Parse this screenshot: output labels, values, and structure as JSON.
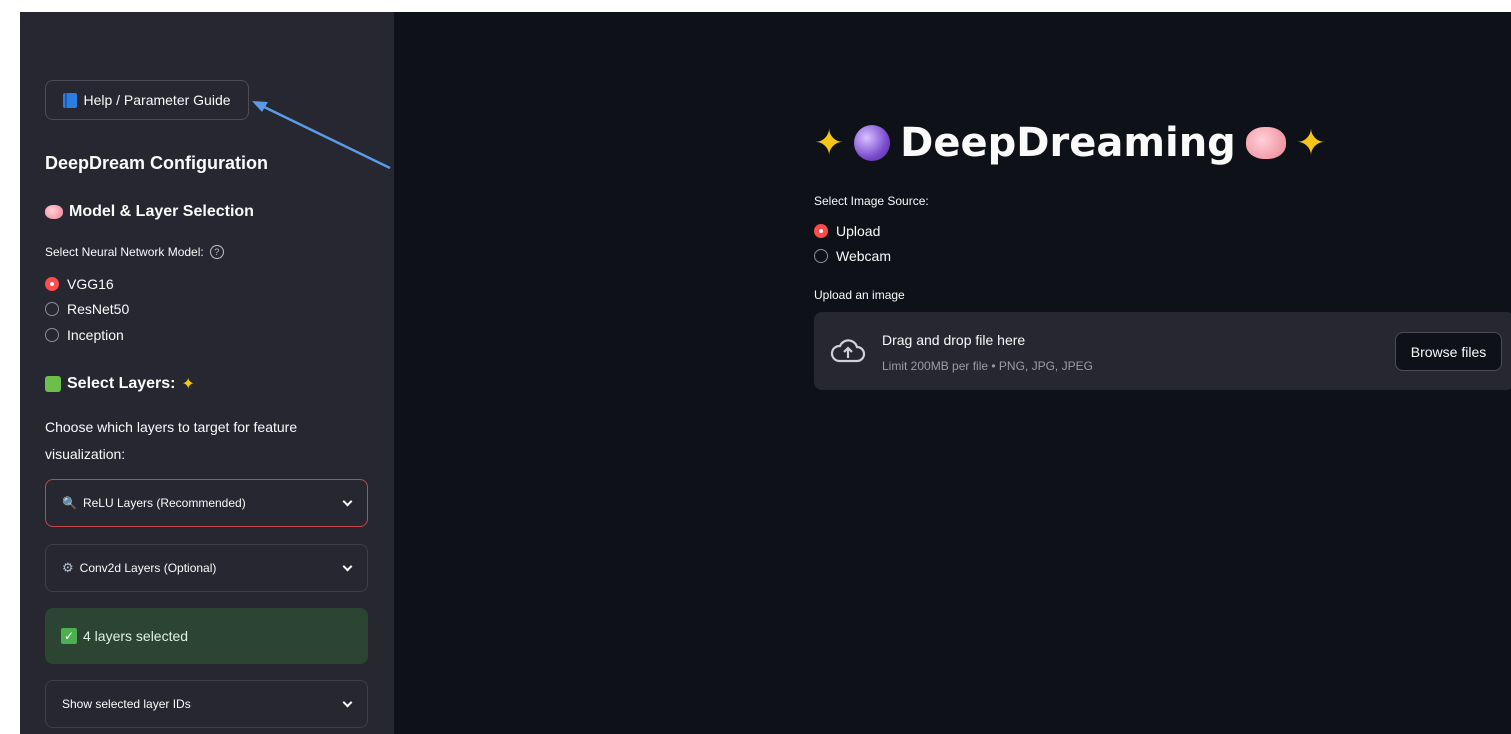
{
  "sidebar": {
    "help_button": "Help / Parameter Guide",
    "config_title": "DeepDream Configuration",
    "model_section": {
      "heading": "Model & Layer Selection",
      "select_label": "Select Neural Network Model:",
      "options": [
        "VGG16",
        "ResNet50",
        "Inception"
      ],
      "selected": "VGG16"
    },
    "layers_section": {
      "heading": "Select Layers:",
      "description": "Choose which layers to target for feature visualization:",
      "relu_expander": "ReLU Layers (Recommended)",
      "conv_expander": "Conv2d Layers (Optional)",
      "status": "4 layers selected",
      "show_ids_expander": "Show selected layer IDs"
    }
  },
  "main": {
    "title": "DeepDreaming",
    "source_label": "Select Image Source:",
    "source_options": [
      "Upload",
      "Webcam"
    ],
    "source_selected": "Upload",
    "upload_label": "Upload an image",
    "uploader": {
      "main_text": "Drag and drop file here",
      "sub_text": "Limit 200MB per file • PNG, JPG, JPEG",
      "browse_label": "Browse files"
    }
  },
  "colors": {
    "accent": "#ff4b4b",
    "sidebar_bg": "#262730",
    "main_bg": "#0e1117",
    "success_bg": "#2c4532"
  }
}
